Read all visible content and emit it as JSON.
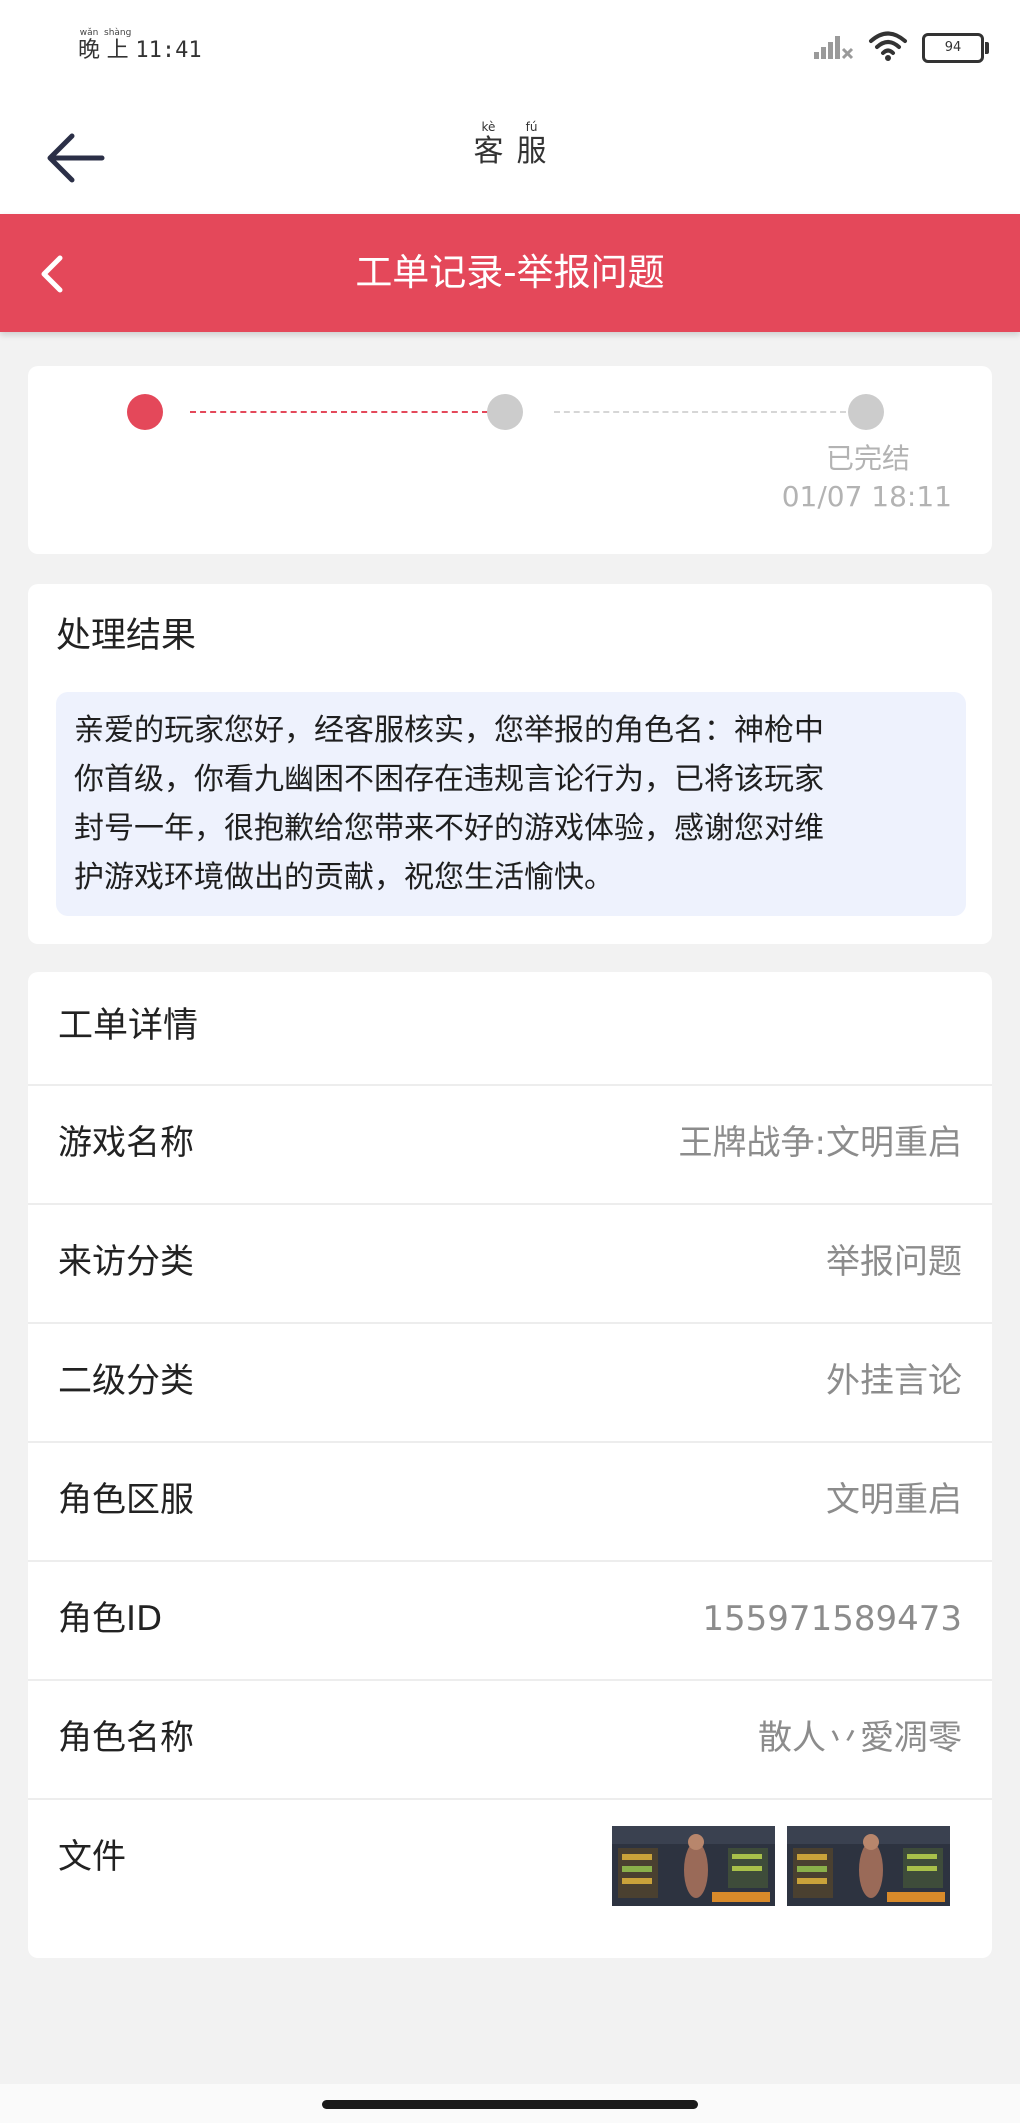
{
  "status_bar": {
    "time_prefix_chars": [
      "晚",
      "上"
    ],
    "time_prefix_pinyin": [
      "wǎn",
      "shàng"
    ],
    "clock": "11:41",
    "battery_level": "94",
    "icons": [
      "signal-icon",
      "wifi-icon",
      "battery-icon"
    ]
  },
  "app_header": {
    "title_chars": [
      "客",
      "服"
    ],
    "title_pinyin": [
      "kè",
      "fú"
    ],
    "back_icon": "arrow-left-icon"
  },
  "nav": {
    "title": "工单记录-举报问题",
    "back_icon": "chevron-left-icon",
    "accent_color": "#e4485a"
  },
  "progress": {
    "steps": [
      {
        "state": "active"
      },
      {
        "state": "pending"
      },
      {
        "state": "pending"
      }
    ],
    "final_label": "已完结",
    "final_time": "01/07 18:11"
  },
  "result": {
    "title": "处理结果",
    "lines": [
      "亲爱的玩家您好，经客服核实，您举报的角色名：神枪中",
      "你首级，你看九幽困不困存在违规言论行为，已将该玩家",
      "封号一年，很抱歉给您带来不好的游戏体验，感谢您对维",
      "护游戏环境做出的贡献，祝您生活愉快。"
    ]
  },
  "details": {
    "title": "工单详情",
    "rows": [
      {
        "label": "游戏名称",
        "value": "王牌战争:文明重启"
      },
      {
        "label": "来访分类",
        "value": "举报问题"
      },
      {
        "label": "二级分类",
        "value": "外挂言论"
      },
      {
        "label": "角色区服",
        "value": "文明重启"
      },
      {
        "label": "角色ID",
        "value": "155971589473"
      },
      {
        "label": "角色名称",
        "value": "散人丷愛凋零"
      }
    ],
    "file_label": "文件",
    "files": [
      "screenshot-thumbnail-1",
      "screenshot-thumbnail-2"
    ]
  }
}
